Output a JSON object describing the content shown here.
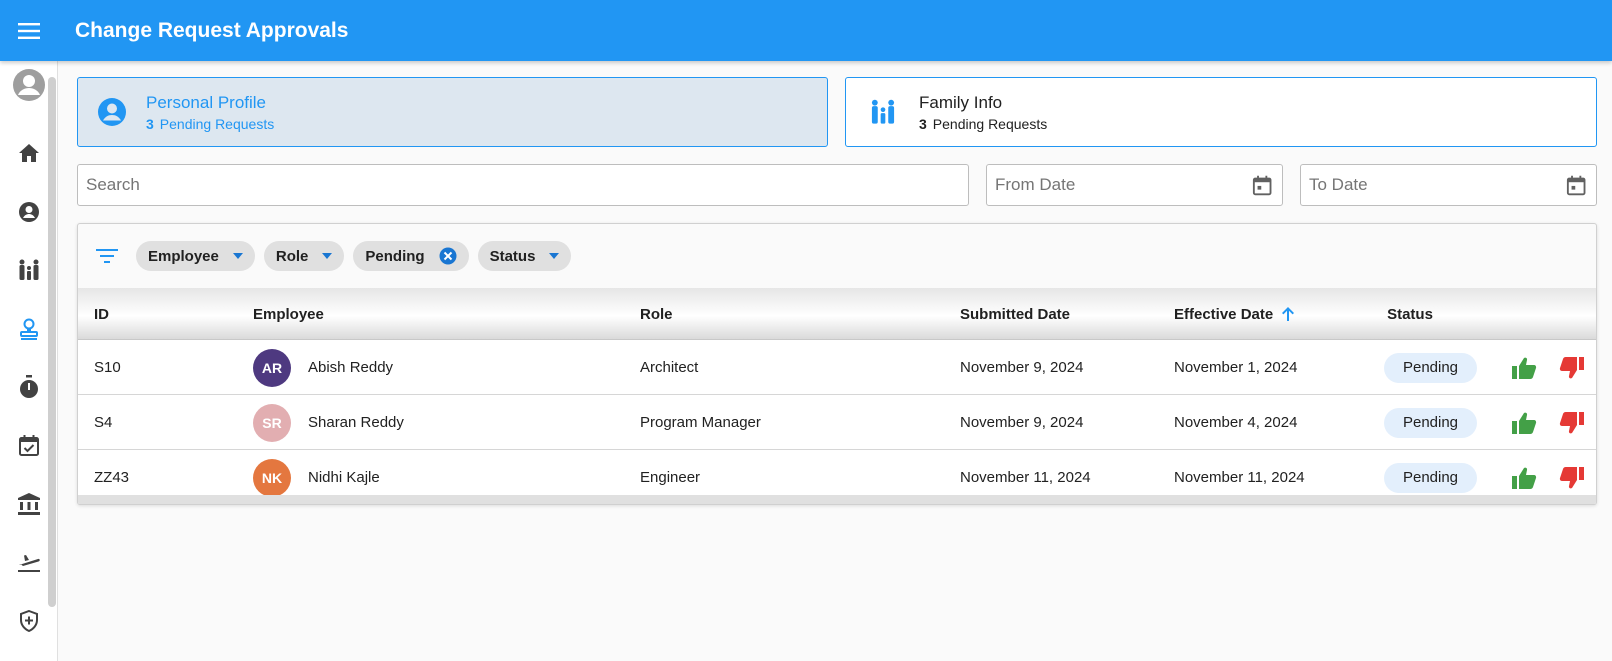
{
  "app": {
    "title": "Change Request Approvals"
  },
  "cards": [
    {
      "title": "Personal Profile",
      "count": "3",
      "label": "Pending Requests"
    },
    {
      "title": "Family Info",
      "count": "3",
      "label": "Pending Requests"
    }
  ],
  "search": {
    "placeholder": "Search",
    "value": ""
  },
  "from_date": {
    "placeholder": "From Date"
  },
  "to_date": {
    "placeholder": "To Date"
  },
  "filters": [
    {
      "label": "Employee",
      "kind": "dropdown"
    },
    {
      "label": "Role",
      "kind": "dropdown"
    },
    {
      "label": "Pending",
      "kind": "removable"
    },
    {
      "label": "Status",
      "kind": "dropdown"
    }
  ],
  "table": {
    "columns": [
      "ID",
      "Employee",
      "Role",
      "Submitted Date",
      "Effective Date",
      "Status"
    ],
    "sort_column": "Effective Date",
    "rows": [
      {
        "id": "S10",
        "initials": "AR",
        "avatar_color": "#4e3980",
        "employee": "Abish Reddy",
        "role": "Architect",
        "submitted": "November 9, 2024",
        "effective": "November 1, 2024",
        "status": "Pending"
      },
      {
        "id": "S4",
        "initials": "SR",
        "avatar_color": "#e2aeb1",
        "employee": "Sharan Reddy",
        "role": "Program Manager",
        "submitted": "November 9, 2024",
        "effective": "November 4, 2024",
        "status": "Pending"
      },
      {
        "id": "ZZ43",
        "initials": "NK",
        "avatar_color": "#e4773f",
        "employee": "Nidhi Kajle",
        "role": "Engineer",
        "submitted": "November 11, 2024",
        "effective": "November 11, 2024",
        "status": "Pending"
      }
    ]
  },
  "sidebar": {
    "items": [
      "home-icon",
      "person-icon",
      "family-icon",
      "approval-stamp-icon",
      "timer-icon",
      "calendar-check-icon",
      "bank-icon",
      "flight-icon",
      "shield-icon"
    ]
  },
  "colors": {
    "primary": "#2196f3",
    "approve": "#43a047",
    "reject": "#e53935"
  }
}
